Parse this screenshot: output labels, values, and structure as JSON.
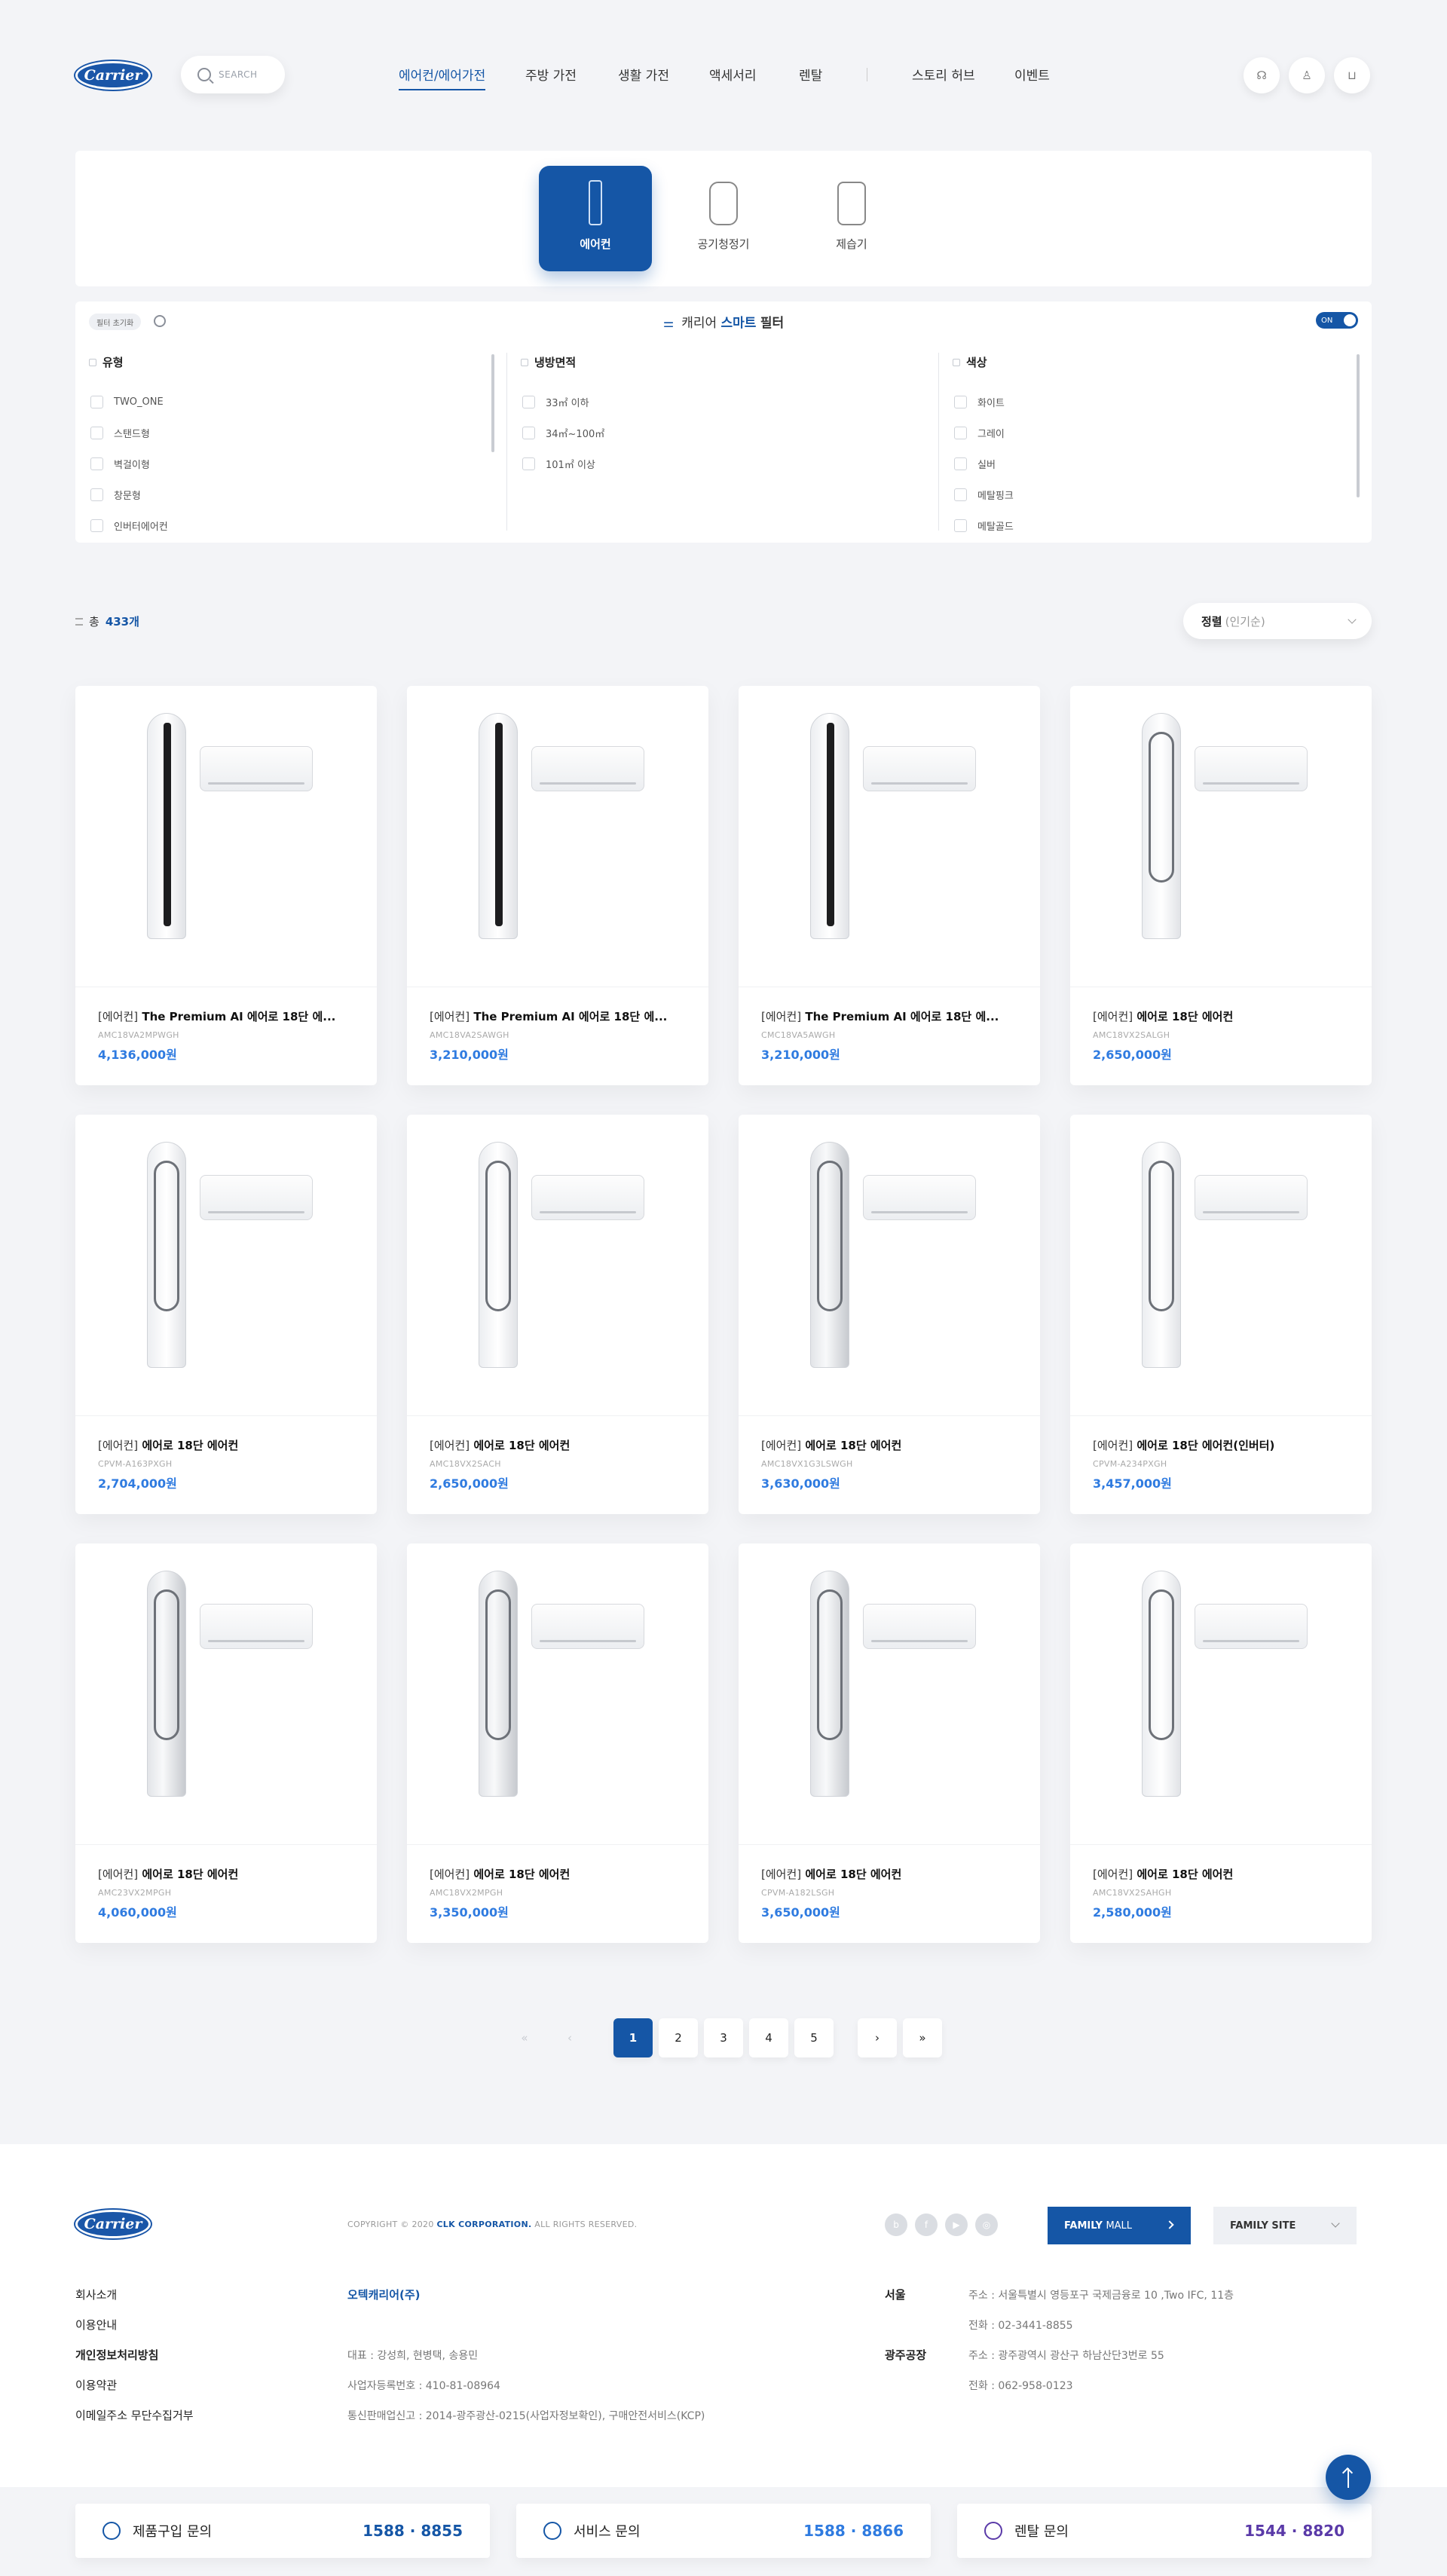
{
  "header": {
    "logo_text": "Carrier",
    "search_placeholder": "SEARCH",
    "nav": [
      "에어컨/에어가전",
      "주방 가전",
      "생활 가전",
      "액세서리",
      "렌탈",
      "스토리 허브",
      "이벤트"
    ],
    "active_nav": "에어컨/에어가전"
  },
  "categories": [
    {
      "label": "에어컨",
      "active": true,
      "icon": "air-conditioner-icon"
    },
    {
      "label": "공기청정기",
      "active": false,
      "icon": "air-purifier-icon"
    },
    {
      "label": "제습기",
      "active": false,
      "icon": "dehumidifier-icon"
    }
  ],
  "filter": {
    "reset_label": "필터 초기화",
    "title_prefix": "캐리어",
    "title_highlight": "스마트",
    "title_suffix": "필터",
    "toggle_label": "ON",
    "groups": [
      {
        "title": "유형",
        "options": [
          "TWO_ONE",
          "스탠드형",
          "벽걸이형",
          "창문형",
          "인버터에어컨"
        ]
      },
      {
        "title": "냉방면적",
        "options": [
          "33㎡ 이하",
          "34㎡~100㎡",
          "101㎡ 이상"
        ]
      },
      {
        "title": "색상",
        "options": [
          "화이트",
          "그레이",
          "실버",
          "메탈핑크",
          "메탈골드"
        ]
      }
    ]
  },
  "list": {
    "count_prefix": "총",
    "count_value": "433개",
    "sort_label": "정렬",
    "sort_value": "(인기순)"
  },
  "products": [
    {
      "tag": "[에어컨]",
      "name": "The Premium AI 에어로 18단 에...",
      "model": "AMC18VA2MPWGH",
      "price": "4,136,000원",
      "style": "black"
    },
    {
      "tag": "[에어컨]",
      "name": "The Premium AI 에어로 18단 에...",
      "model": "AMC18VA2SAWGH",
      "price": "3,210,000원",
      "style": "black"
    },
    {
      "tag": "[에어컨]",
      "name": "The Premium AI 에어로 18단 에...",
      "model": "CMC18VA5AWGH",
      "price": "3,210,000원",
      "style": "black"
    },
    {
      "tag": "[에어컨]",
      "name": "에어로 18단 에어컨",
      "model": "AMC18VX2SALGH",
      "price": "2,650,000원",
      "style": "white"
    },
    {
      "tag": "[에어컨]",
      "name": "에어로 18단 에어컨",
      "model": "CPVM-A163PXGH",
      "price": "2,704,000원",
      "style": "white"
    },
    {
      "tag": "[에어컨]",
      "name": "에어로 18단 에어컨",
      "model": "AMC18VX2SACH",
      "price": "2,650,000원",
      "style": "white"
    },
    {
      "tag": "[에어컨]",
      "name": "에어로 18단 에어컨",
      "model": "AMC18VX1G3LSWGH",
      "price": "3,630,000원",
      "style": "silver"
    },
    {
      "tag": "[에어컨]",
      "name": "에어로 18단 에어컨(인버터)",
      "model": "CPVM-A234PXGH",
      "price": "3,457,000원",
      "style": "white"
    },
    {
      "tag": "[에어컨]",
      "name": "에어로 18단 에어컨",
      "model": "AMC23VX2MPGH",
      "price": "4,060,000원",
      "style": "silver"
    },
    {
      "tag": "[에어컨]",
      "name": "에어로 18단 에어컨",
      "model": "AMC18VX2MPGH",
      "price": "3,350,000원",
      "style": "silver"
    },
    {
      "tag": "[에어컨]",
      "name": "에어로 18단 에어컨",
      "model": "CPVM-A182LSGH",
      "price": "3,650,000원",
      "style": "silver"
    },
    {
      "tag": "[에어컨]",
      "name": "에어로 18단 에어컨",
      "model": "AMC18VX2SAHGH",
      "price": "2,580,000원",
      "style": "white"
    }
  ],
  "pagination": {
    "pages": [
      "1",
      "2",
      "3",
      "4",
      "5"
    ],
    "current": "1",
    "first": "«",
    "prev": "‹",
    "next": "›",
    "last": "»"
  },
  "footer": {
    "logo_text": "Carrier",
    "copyright_prefix": "COPYRIGHT © 2020",
    "copyright_company": "CLK CORPORATION.",
    "copyright_suffix": "ALL RIGHTS RESERVED.",
    "family_mall_bold": "FAMILY",
    "family_mall_rest": "MALL",
    "family_site": "FAMILY SITE",
    "links": [
      "회사소개",
      "이용안내",
      "개인정보처리방침",
      "이용약관",
      "이메일주소 무단수집거부"
    ],
    "company_name": "오텍캐리어(주)",
    "ceo": "대표 : 강성희, 현병택, 송용민",
    "biz_no": "사업자등록번호 : 410-81-08964",
    "ecom_no": "통신판매업신고 : 2014-광주광산-0215(사업자정보확인), 구매안전서비스(KCP)",
    "seoul_label": "서울",
    "seoul_addr": "주소 : 서울특별시 영등포구 국제금융로 10 ,Two IFC, 11층",
    "seoul_tel": "전화 : 02-3441-8855",
    "factory_label": "광주공장",
    "factory_addr": "주소 : 광주광역시 광산구 하남산단3번로 55",
    "factory_tel": "전화 : 062-958-0123"
  },
  "contacts": [
    {
      "label": "제품구입 문의",
      "number": "1588 · 8855",
      "color": "#1556a6"
    },
    {
      "label": "서비스 문의",
      "number": "1588 · 8866",
      "color": "#2f7be0"
    },
    {
      "label": "렌탈 문의",
      "number": "1544 · 8820",
      "color": "#5a3aa8"
    }
  ]
}
